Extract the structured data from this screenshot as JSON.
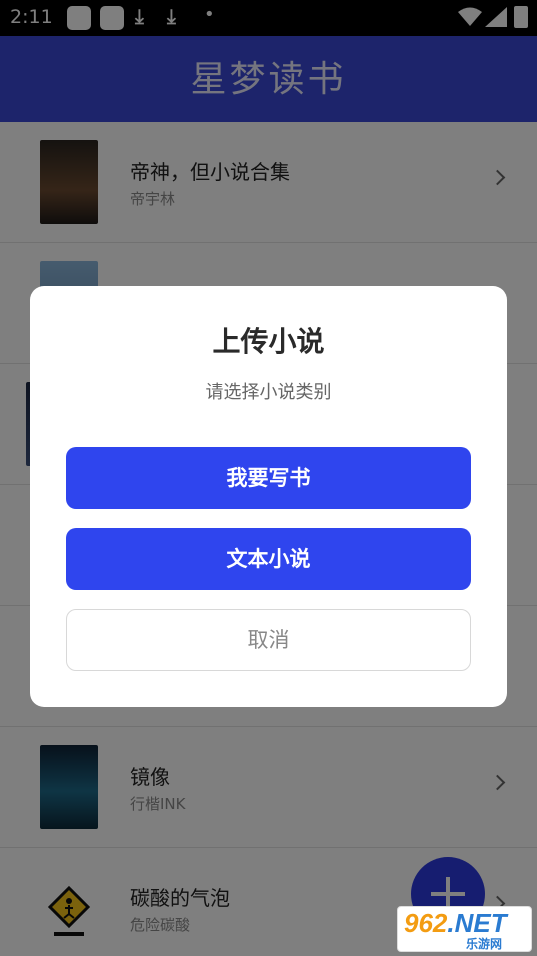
{
  "status_bar": {
    "time": "2:11",
    "download_icon": "download-icon",
    "dot": "•"
  },
  "app": {
    "title": "星梦读书"
  },
  "books": [
    {
      "title": "帝神，但小说合集",
      "author": "帝宇林",
      "cover_color": "#4a3a2e"
    },
    {
      "title": "",
      "author": "",
      "cover_color": "#6f9cc4"
    },
    {
      "title": "",
      "author": "",
      "cover_color": "#2b3a5a"
    },
    {
      "title": "",
      "author": "",
      "cover_color": "#cccccc"
    },
    {
      "title": "",
      "author": "",
      "cover_color": "#cccccc"
    },
    {
      "title": "镜像",
      "author": "行楷INK",
      "cover_color": "#1f4e6b"
    },
    {
      "title": "碳酸的气泡",
      "author": "危险碳酸",
      "cover_color": "#f2f2f2"
    }
  ],
  "dialog": {
    "title": "上传小说",
    "subtitle": "请选择小说类别",
    "write_button": "我要写书",
    "text_button": "文本小说",
    "cancel_button": "取消"
  },
  "watermark": {
    "main_orange": "962",
    "main_blue": ".NET",
    "sub": "乐游网"
  },
  "colors": {
    "header": "#3a48d6",
    "primary_button": "#2f45ee",
    "fab": "#2d3be0"
  }
}
